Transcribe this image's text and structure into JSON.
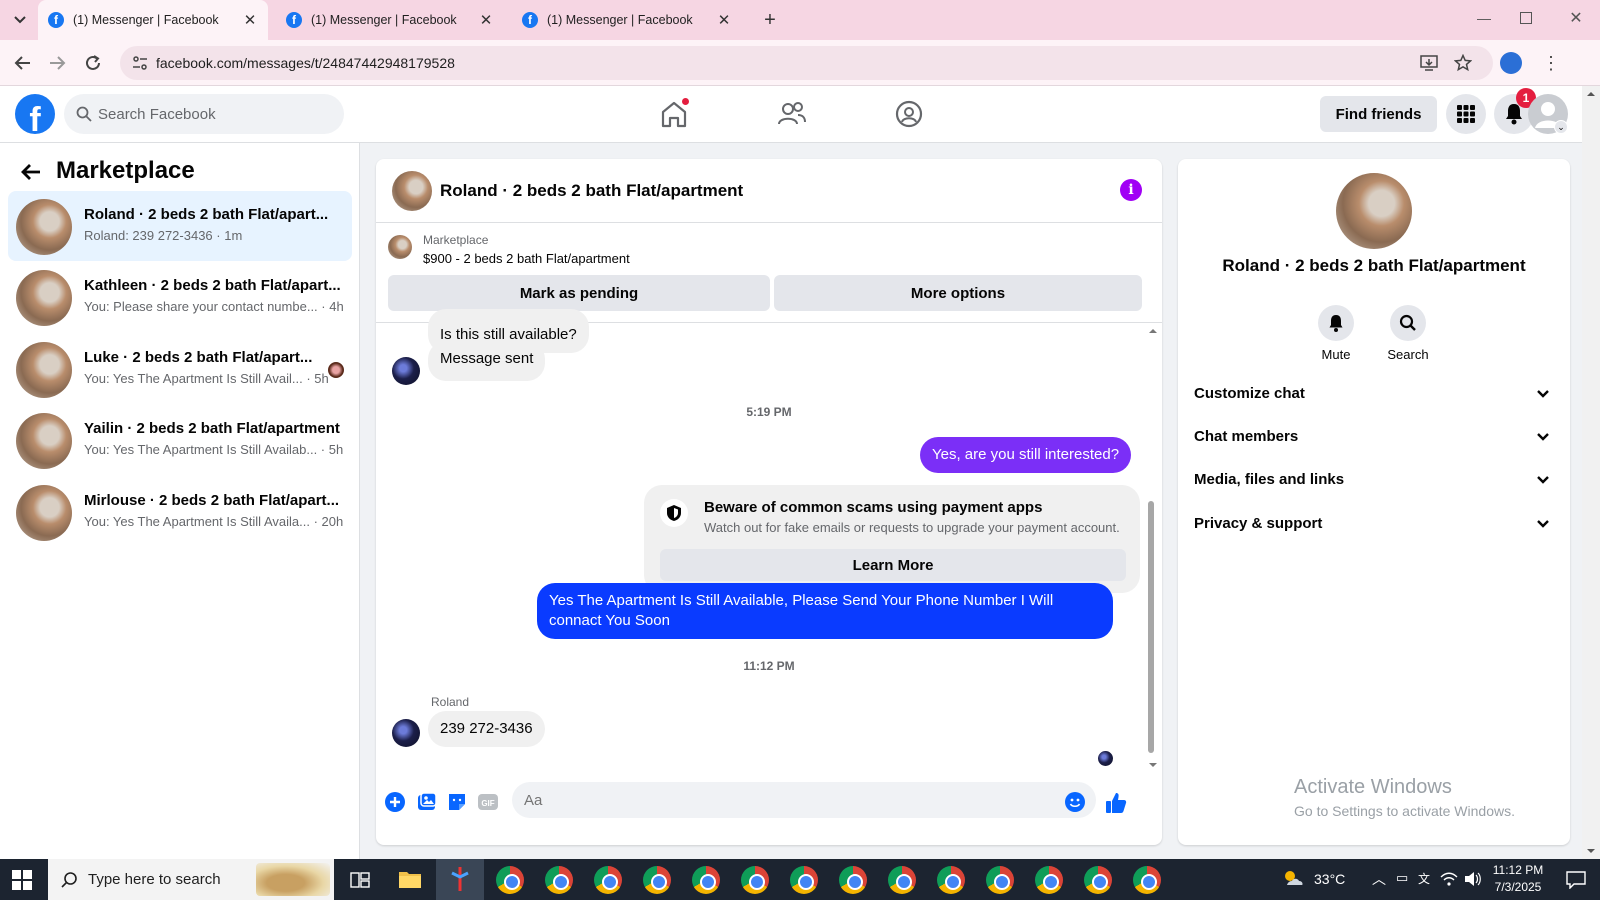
{
  "browser": {
    "tabs": [
      {
        "title": "(1) Messenger | Facebook",
        "favicon": "facebook-icon"
      },
      {
        "title": "(1) Messenger | Facebook",
        "favicon": "facebook-icon"
      },
      {
        "title": "(1) Messenger | Facebook",
        "favicon": "facebook-icon"
      }
    ],
    "url": "facebook.com/messages/t/24847442948179528"
  },
  "fb_header": {
    "search_placeholder": "Search Facebook",
    "find_friends": "Find friends",
    "notif_count": "1",
    "logo_letter": "f"
  },
  "sidebar": {
    "title": "Marketplace",
    "conversations": [
      {
        "name": "Roland · 2 beds 2 bath Flat/apart...",
        "snippet": "Roland: 239 272-3436 · 1m"
      },
      {
        "name": "Kathleen · 2 beds 2 bath Flat/apart...",
        "snippet": "You: Please share your contact numbe... · 4h"
      },
      {
        "name": "Luke · 2 beds 2 bath Flat/apart...",
        "snippet": "You: Yes The Apartment Is Still Avail... · 5h"
      },
      {
        "name": "Yailin · 2 beds 2 bath Flat/apartment",
        "snippet": "You: Yes The Apartment Is Still Availab... · 5h"
      },
      {
        "name": "Mirlouse · 2 beds 2 bath Flat/apart...",
        "snippet": "You: Yes The Apartment Is Still Availa... · 20h"
      }
    ]
  },
  "chat": {
    "title": "Roland · 2 beds 2 bath Flat/apartment",
    "info_glyph": "i",
    "marketplace_label": "Marketplace",
    "listing": "$900 - 2 beds 2 bath Flat/apartment",
    "mark_pending": "Mark as pending",
    "more_options": "More options",
    "messages": {
      "m1": "Is this still available?",
      "m2": "Message sent",
      "ts1": "5:19 PM",
      "m3": "Yes, are you still interested?",
      "scam_title": "Beware of common scams using payment apps",
      "scam_desc": "Watch out for fake emails or requests to upgrade your payment account.",
      "learn_more": "Learn More",
      "m4": "Yes The Apartment Is Still Available, Please Send Your Phone Number I Will connact You Soon",
      "ts2": "11:12 PM",
      "sender": "Roland",
      "m5": "239 272-3436"
    },
    "composer_placeholder": "Aa"
  },
  "details": {
    "name": "Roland · 2 beds 2 bath Flat/apartment",
    "mute": "Mute",
    "search": "Search",
    "sections": [
      "Customize chat",
      "Chat members",
      "Media, files and links",
      "Privacy & support"
    ]
  },
  "watermark": {
    "line1": "Activate Windows",
    "line2": "Go to Settings to activate Windows."
  },
  "taskbar": {
    "search_placeholder": "Type here to search",
    "temperature": "33°C",
    "time": "11:12 PM",
    "date": "7/3/2025"
  },
  "colors": {
    "fb_blue": "#1877f2",
    "accent_purple": "#7b2ff7",
    "outgoing_blue": "#0a3bff",
    "notif_red": "#e41e3f"
  }
}
